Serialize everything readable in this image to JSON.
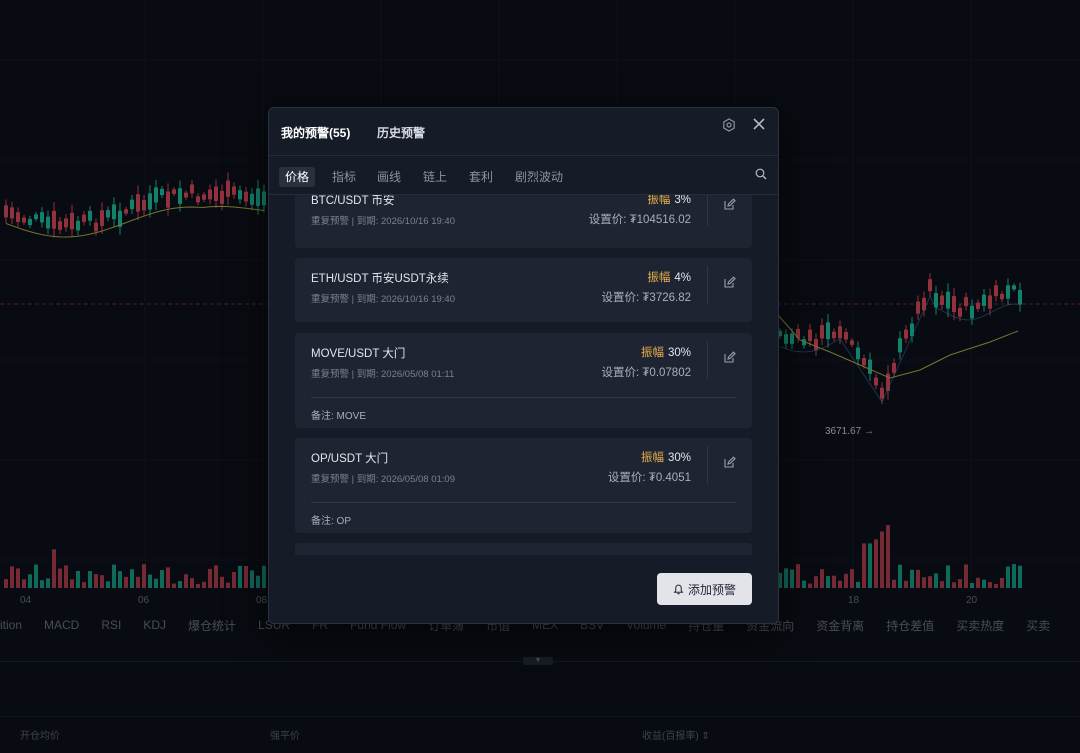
{
  "colors": {
    "up": "#1ec8a5",
    "down": "#e04d5f",
    "accent": "#e8b04a",
    "bg": "#0d111b"
  },
  "chart_background": {
    "x_labels": [
      "04",
      "06",
      "08",
      "18",
      "20"
    ],
    "price_marker": "3671.67 →"
  },
  "indicators": [
    "sition",
    "MACD",
    "RSI",
    "KDJ",
    "爆仓统计",
    "LSUR",
    "FR",
    "Fund Flow",
    "订单簿",
    "市值",
    "MEX",
    "BSV",
    "Volume",
    "持仓量",
    "资金流向",
    "资金背离",
    "持仓差值",
    "买卖热度",
    "买卖"
  ],
  "bottom_header": {
    "avg_open": "开仓均价",
    "liq_price": "强平价",
    "pnl": "收益(百报率) ⇕"
  },
  "modal": {
    "tabs": {
      "mine": "我的预警(55)",
      "history": "历史预警"
    },
    "subtabs": [
      "价格",
      "指标",
      "画线",
      "链上",
      "套利",
      "剧烈波动"
    ],
    "active_subtab": 0,
    "alerts": [
      {
        "pair": "BTC/USDT  币安",
        "meta": "重复预警 | 到期: 2026/10/16 19:40",
        "amp_label": "振幅",
        "amp_value": "3%",
        "set_price": "设置价: ₮104516.02",
        "note": ""
      },
      {
        "pair": "ETH/USDT  币安USDT永续",
        "meta": "重复预警 | 到期: 2026/10/16 19:40",
        "amp_label": "振幅",
        "amp_value": "4%",
        "set_price": "设置价: ₮3726.82",
        "note": ""
      },
      {
        "pair": "MOVE/USDT  大门",
        "meta": "重复预警 | 到期: 2026/05/08 01:11",
        "amp_label": "振幅",
        "amp_value": "30%",
        "set_price": "设置价: ₮0.07802",
        "note": "备注: MOVE"
      },
      {
        "pair": "OP/USDT  大门",
        "meta": "重复预警 | 到期: 2026/05/08 01:09",
        "amp_label": "振幅",
        "amp_value": "30%",
        "set_price": "设置价: ₮0.4051",
        "note": "备注: OP"
      }
    ],
    "add_button": "添加预警"
  },
  "icons": {
    "settings": "settings-icon",
    "close": "close-icon",
    "search": "search-icon",
    "edit": "edit-icon",
    "bell": "bell-icon"
  }
}
